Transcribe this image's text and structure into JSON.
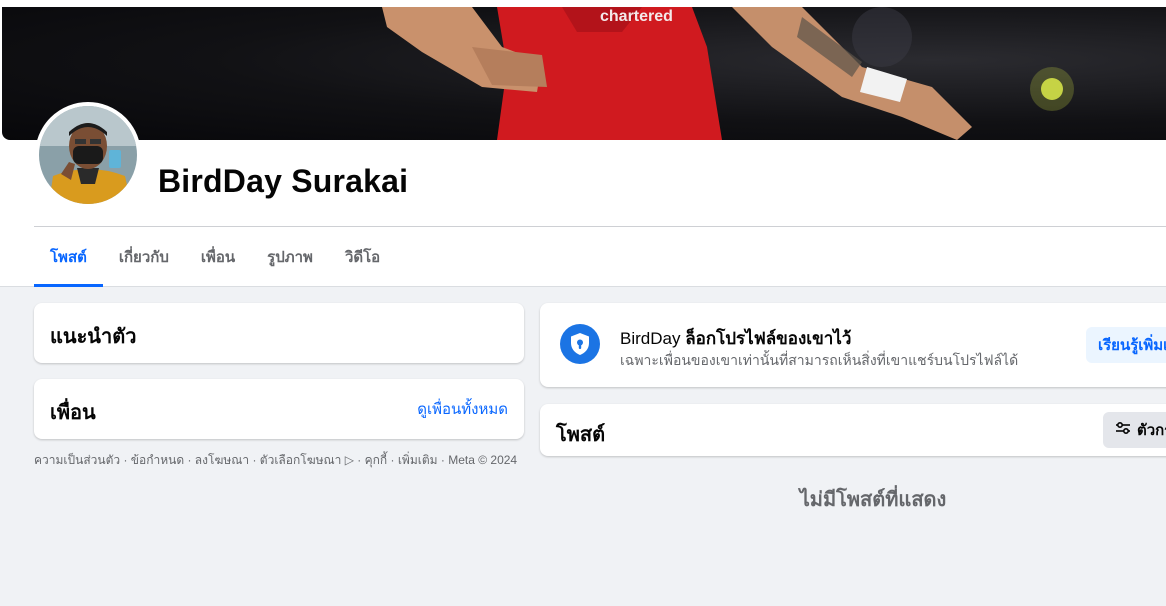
{
  "profile": {
    "name": "BirdDay Surakai"
  },
  "tabs": [
    {
      "label": "โพสต์",
      "active": true
    },
    {
      "label": "เกี่ยวกับ",
      "active": false
    },
    {
      "label": "เพื่อน",
      "active": false
    },
    {
      "label": "รูปภาพ",
      "active": false
    },
    {
      "label": "วิดีโอ",
      "active": false
    }
  ],
  "intro": {
    "title": "แนะนำตัว"
  },
  "friends": {
    "title": "เพื่อน",
    "see_all": "ดูเพื่อนทั้งหมด"
  },
  "footer": {
    "text": "ความเป็นส่วนตัว · ข้อกำหนด · ลงโฆษณา · ตัวเลือกโฆษณา ▷ · คุกกี้ · เพิ่มเติม · Meta © 2024"
  },
  "lock_notice": {
    "name": "BirdDay",
    "title_rest": "ล็อกโปรไฟล์ของเขาไว้",
    "description": "เฉพาะเพื่อนของเขาเท่านั้นที่สามารถเห็นสิ่งที่เขาแชร์บนโปรไฟล์ได้",
    "button": "เรียนรู้เพิ่มเติม"
  },
  "posts": {
    "title": "โพสต์",
    "filter_button": "ตัวกรอง",
    "empty_message": "ไม่มีโพสต์ที่แสดง"
  },
  "colors": {
    "accent": "#0866ff",
    "lock_icon_bg": "#1b74e4",
    "page_bg": "#f0f2f5"
  },
  "icons": {
    "lock": "shield-lock-icon",
    "filter": "filter-sliders-icon"
  }
}
